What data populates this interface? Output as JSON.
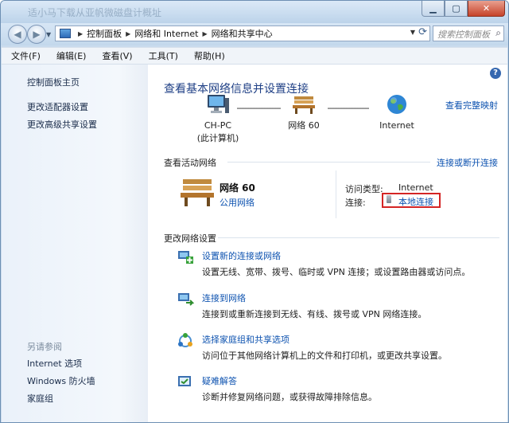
{
  "window": {
    "title": "适小马下载从亚帆微磁盘计概址"
  },
  "window_controls": {
    "minimize": "▁",
    "maximize": "▢",
    "close": "✕"
  },
  "address": {
    "crumbs": [
      "控制面板",
      "网络和 Internet",
      "网络和共享中心"
    ],
    "search_placeholder": "搜索控制面板"
  },
  "menu": [
    "文件(F)",
    "编辑(E)",
    "查看(V)",
    "工具(T)",
    "帮助(H)"
  ],
  "sidebar": {
    "top_links": [
      "控制面板主页",
      "更改适配器设置",
      "更改高级共享设置"
    ],
    "see_also_heading": "另请参阅",
    "see_also_links": [
      "Internet 选项",
      "Windows 防火墙",
      "家庭组"
    ]
  },
  "main": {
    "title": "查看基本网络信息并设置连接",
    "full_map_link": "查看完整映射",
    "map_nodes": [
      {
        "line1": "CH-PC",
        "line2": "(此计算机)"
      },
      {
        "line1": "网络  60",
        "line2": ""
      },
      {
        "line1": "Internet",
        "line2": ""
      }
    ],
    "active_networks_label": "查看活动网络",
    "connect_disconnect_link": "连接或断开连接",
    "network": {
      "name": "网络  60",
      "type": "公用网络",
      "access_type_label": "访问类型:",
      "access_type_value": "Internet",
      "connections_label": "连接:",
      "connections_value": "本地连接"
    },
    "change_settings_label": "更改网络设置",
    "tasks": [
      {
        "title": "设置新的连接或网络",
        "desc": "设置无线、宽带、拨号、临时或 VPN 连接；或设置路由器或访问点。"
      },
      {
        "title": "连接到网络",
        "desc": "连接到或重新连接到无线、有线、拨号或 VPN 网络连接。"
      },
      {
        "title": "选择家庭组和共享选项",
        "desc": "访问位于其他网络计算机上的文件和打印机，或更改共享设置。"
      },
      {
        "title": "疑难解答",
        "desc": "诊断并修复网络问题，或获得故障排除信息。"
      }
    ]
  },
  "colors": {
    "link": "#0e53b0",
    "title": "#1e3f85",
    "highlight_box": "#d42525"
  }
}
